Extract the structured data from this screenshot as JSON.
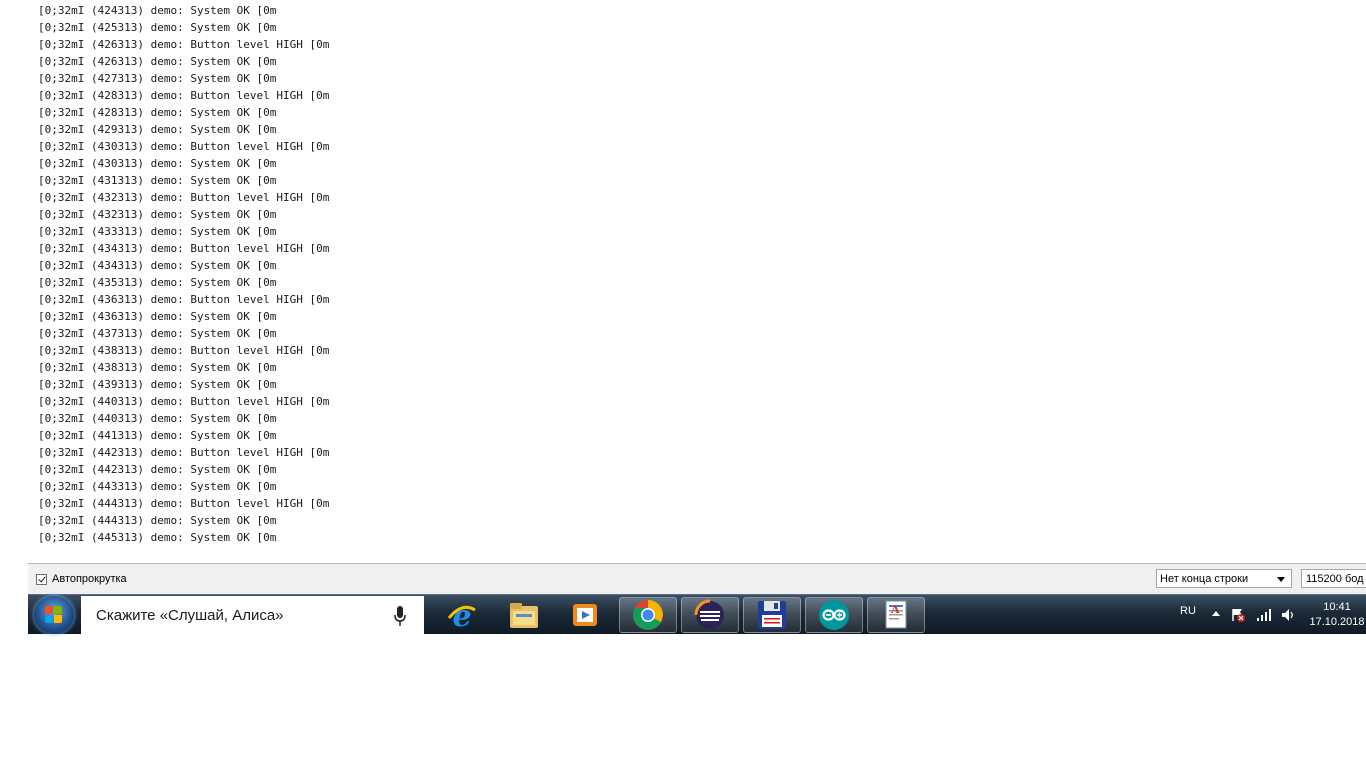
{
  "console": {
    "lines": [
      "[0;32mI (424313) demo: System OK [0m",
      "[0;32mI (425313) demo: System OK [0m",
      "[0;32mI (426313) demo: Button level HIGH [0m",
      "[0;32mI (426313) demo: System OK [0m",
      "[0;32mI (427313) demo: System OK [0m",
      "[0;32mI (428313) demo: Button level HIGH [0m",
      "[0;32mI (428313) demo: System OK [0m",
      "[0;32mI (429313) demo: System OK [0m",
      "[0;32mI (430313) demo: Button level HIGH [0m",
      "[0;32mI (430313) demo: System OK [0m",
      "[0;32mI (431313) demo: System OK [0m",
      "[0;32mI (432313) demo: Button level HIGH [0m",
      "[0;32mI (432313) demo: System OK [0m",
      "[0;32mI (433313) demo: System OK [0m",
      "[0;32mI (434313) demo: Button level HIGH [0m",
      "[0;32mI (434313) demo: System OK [0m",
      "[0;32mI (435313) demo: System OK [0m",
      "[0;32mI (436313) demo: Button level HIGH [0m",
      "[0;32mI (436313) demo: System OK [0m",
      "[0;32mI (437313) demo: System OK [0m",
      "[0;32mI (438313) demo: Button level HIGH [0m",
      "[0;32mI (438313) demo: System OK [0m",
      "[0;32mI (439313) demo: System OK [0m",
      "[0;32mI (440313) demo: Button level HIGH [0m",
      "[0;32mI (440313) demo: System OK [0m",
      "[0;32mI (441313) demo: System OK [0m",
      "[0;32mI (442313) demo: Button level HIGH [0m",
      "[0;32mI (442313) demo: System OK [0m",
      "[0;32mI (443313) demo: System OK [0m",
      "[0;32mI (444313) demo: Button level HIGH [0m",
      "[0;32mI (444313) demo: System OK [0m",
      "[0;32mI (445313) demo: System OK [0m"
    ]
  },
  "statusbar": {
    "autoscroll_label": "Автопрокрутка",
    "autoscroll_checked": true,
    "line_ending": "Нет конца строки",
    "baud_rate": "115200 бод"
  },
  "taskbar": {
    "search_placeholder": "Скажите «Слушай, Алиса»",
    "apps": [
      {
        "icon": "internet-explorer-icon"
      },
      {
        "icon": "file-explorer-icon"
      },
      {
        "icon": "media-player-icon"
      },
      {
        "icon": "chrome-icon"
      },
      {
        "icon": "eclipse-icon"
      },
      {
        "icon": "floppy-save-icon"
      },
      {
        "icon": "arduino-icon"
      },
      {
        "icon": "document-icon"
      }
    ],
    "tray": {
      "language": "RU",
      "time": "10:41",
      "date": "17.10.2018"
    }
  },
  "colors": {
    "taskbar": "#1c2a38",
    "console_bg": "#ffffff",
    "arduino": "#00979c"
  }
}
